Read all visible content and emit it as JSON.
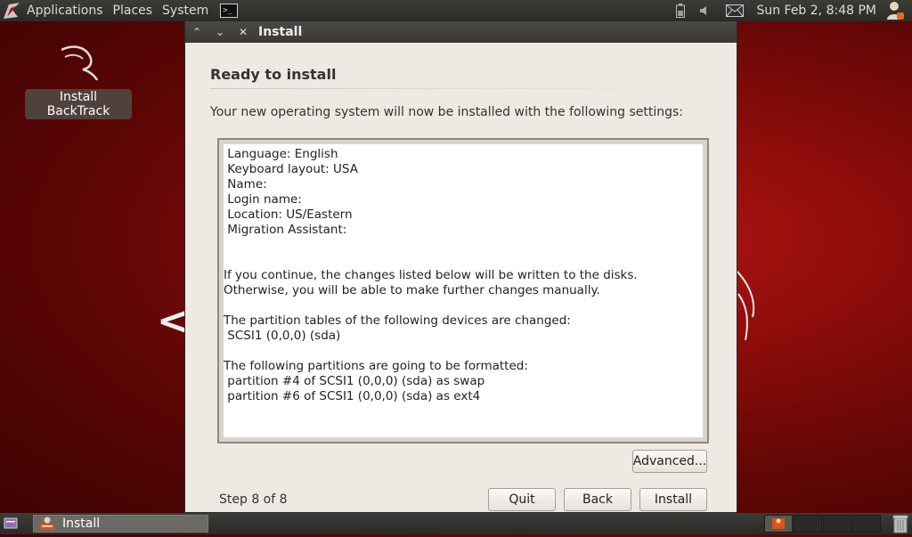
{
  "top_panel": {
    "menus": [
      "Applications",
      "Places",
      "System"
    ],
    "clock": "Sun Feb  2,  8:48 PM"
  },
  "desktop": {
    "icon_label": "Install BackTrack"
  },
  "window": {
    "title": "Install",
    "heading": "Ready to install",
    "description": "Your new operating system will now be installed with the following settings:",
    "summary_lines": [
      " Language: English",
      " Keyboard layout: USA",
      " Name: ",
      " Login name: ",
      " Location: US/Eastern",
      " Migration Assistant: ",
      "",
      "",
      "If you continue, the changes listed below will be written to the disks.",
      "Otherwise, you will be able to make further changes manually.",
      "",
      "The partition tables of the following devices are changed:",
      " SCSI1 (0,0,0) (sda)",
      "",
      "The following partitions are going to be formatted:",
      " partition #4 of SCSI1 (0,0,0) (sda) as swap",
      " partition #6 of SCSI1 (0,0,0) (sda) as ext4"
    ],
    "advanced_label": "Advanced...",
    "step_text": "Step 8 of 8",
    "quit_label": "Quit",
    "back_label": "Back",
    "install_label": "Install"
  },
  "bottom_panel": {
    "task_label": "Install"
  },
  "colors": {
    "panel": "#3c3b37",
    "window_bg": "#eeeae3",
    "desktop_red": "#8a0c0a"
  }
}
